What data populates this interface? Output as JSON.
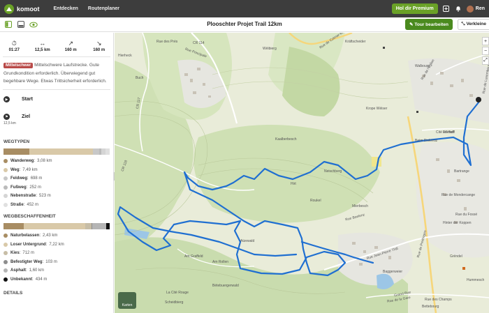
{
  "brand": {
    "name": "komoot"
  },
  "nav": {
    "discover": "Entdecken",
    "planner": "Routenplaner"
  },
  "top_right": {
    "premium_label": "Hol dir Premium",
    "user_name": "Ren"
  },
  "subbar": {
    "title": "Plooschter Projet Trail 12km",
    "edit_label": "Tour bearbeiten",
    "collapse_label": "Verkleine"
  },
  "stats": [
    {
      "icon": "stopwatch-icon",
      "glyph": "⏱",
      "value": "01:27"
    },
    {
      "icon": "distance-icon",
      "glyph": "↔",
      "value": "12,5 km"
    },
    {
      "icon": "uphill-icon",
      "glyph": "↗",
      "value": "160 m"
    },
    {
      "icon": "downhill-icon",
      "glyph": "↘",
      "value": "160 m"
    }
  ],
  "difficulty": {
    "badge": "Mittelschwer",
    "text": "Mittelschwere Laufstrecke. Gute Grundkondition erforderlich. Überwiegend gut begehbare Wege. Etwas Trittsicherheit erforderlich."
  },
  "waypoints": {
    "start": "Start",
    "end": "Ziel",
    "end_distance": "12,5 km"
  },
  "way_types": {
    "title": "WEGTYPEN",
    "items": [
      {
        "name": "Wanderweg",
        "value": "3,08 km",
        "color": "#a88d63",
        "share": 0.246
      },
      {
        "name": "Weg",
        "value": "7,49 km",
        "color": "#d9c9a8",
        "share": 0.599
      },
      {
        "name": "Feldweg",
        "value": "698 m",
        "color": "#c8c8c8",
        "share": 0.056
      },
      {
        "name": "Fußweg",
        "value": "252 m",
        "color": "#bbbbbb",
        "share": 0.02
      },
      {
        "name": "Nebenstraße",
        "value": "523 m",
        "color": "#d5d5d5",
        "share": 0.042
      },
      {
        "name": "Straße",
        "value": "452 m",
        "color": "#e0e0e0",
        "share": 0.036
      }
    ]
  },
  "surfaces": {
    "title": "WEGBESCHAFFENHEIT",
    "items": [
      {
        "name": "Naturbelassen",
        "value": "2,43 km",
        "color": "#a88d63",
        "share": 0.194
      },
      {
        "name": "Loser Untergrund",
        "value": "7,22 km",
        "color": "#d9c9a8",
        "share": 0.578
      },
      {
        "name": "Kies",
        "value": "712 m",
        "color": "#c7bda6",
        "share": 0.057
      },
      {
        "name": "Befestigter Weg",
        "value": "103 m",
        "color": "#8d8d8d",
        "share": 0.008
      },
      {
        "name": "Asphalt",
        "value": "1,60 km",
        "color": "#b5b5b5",
        "share": 0.128
      },
      {
        "name": "Unbekannt",
        "value": "434 m",
        "color": "#111111",
        "share": 0.035
      }
    ]
  },
  "details_title": "DETAILS",
  "map": {
    "layers_label": "Karten",
    "labels": [
      "Rue de Colmar-Berg",
      "Rue Principale",
      "Hierheck",
      "Rue des Prés",
      "Walbourg",
      "Krope Wéiser",
      "Neischberg",
      "Roukel",
      "Wéibierg",
      "Mierbesch",
      "Buch",
      "Im Haff",
      "Kaalberbesch",
      "Bétebuergerwald",
      "Hirt",
      "Scheidbierg",
      "Kräftscheider",
      "CR 118",
      "CR 117",
      "CR 114",
      "Atzewald",
      "Rue du Fossé",
      "Hinter der Koppen",
      "Rue de Prettingen",
      "Bettebourg",
      "Grand Rue",
      "Rue Boelenz",
      "Cité Ellehoff",
      "Bartrange",
      "Rue de l'Eglise",
      "Rue de Mondercange",
      "Rue Jean-Pierre Thill",
      "Rue des Champs",
      "La Cité Rouge",
      "Am Graffeld",
      "Rue de la Gare",
      "Am Rollen",
      "Hummesch",
      "Rue de Luxembourg",
      "Beim Dixkreuz",
      "Grëndel",
      "Baggerweier"
    ]
  },
  "colors": {
    "brand_green": "#6aa127",
    "route_blue": "#1f6fd1",
    "topbar": "#3d3d3d"
  }
}
